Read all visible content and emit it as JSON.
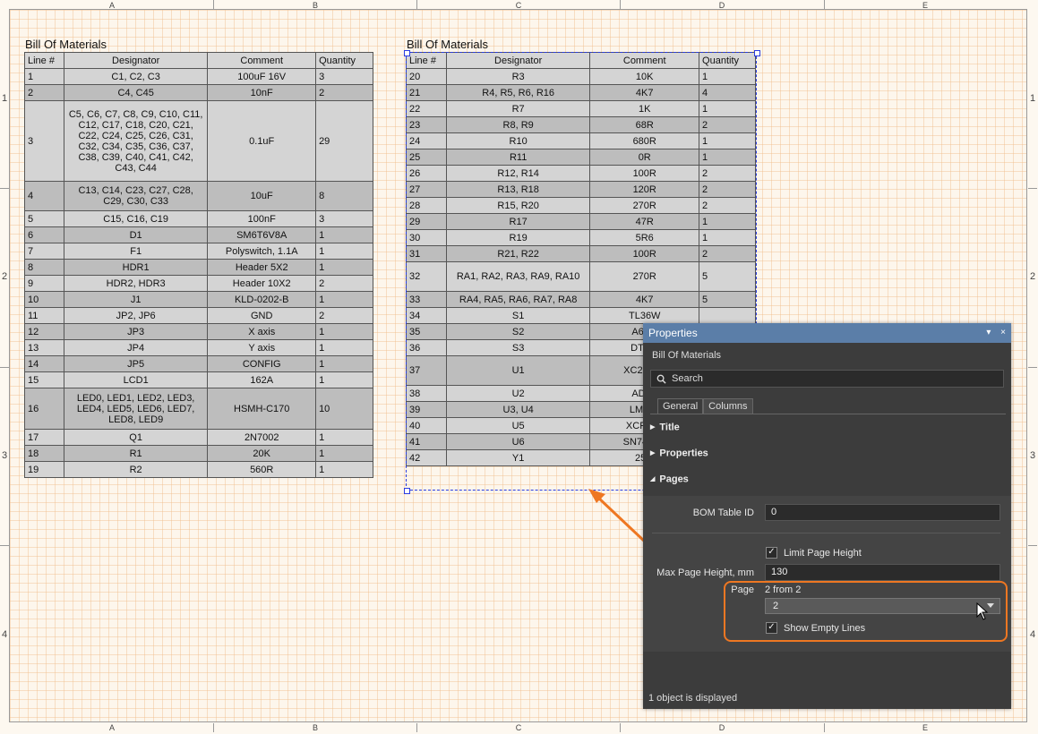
{
  "zones": {
    "cols": [
      "A",
      "B",
      "C",
      "D",
      "E"
    ],
    "rows": [
      "1",
      "2",
      "3",
      "4"
    ]
  },
  "bom1": {
    "title": "Bill Of Materials",
    "headers": [
      "Line #",
      "Designator",
      "Comment",
      "Quantity"
    ],
    "rows": [
      [
        "1",
        "C1, C2, C3",
        "100uF 16V",
        "3"
      ],
      [
        "2",
        "C4, C45",
        "10nF",
        "2"
      ],
      [
        "3",
        "C5, C6, C7, C8, C9, C10, C11, C12, C17, C18, C20, C21, C22, C24, C25, C26, C31, C32, C34, C35, C36, C37, C38, C39, C40, C41, C42, C43, C44",
        "0.1uF",
        "29"
      ],
      [
        "4",
        "C13, C14, C23, C27, C28, C29, C30, C33",
        "10uF",
        "8"
      ],
      [
        "5",
        "C15, C16, C19",
        "100nF",
        "3"
      ],
      [
        "6",
        "D1",
        "SM6T6V8A",
        "1"
      ],
      [
        "7",
        "F1",
        "Polyswitch, 1.1A",
        "1"
      ],
      [
        "8",
        "HDR1",
        "Header 5X2",
        "1"
      ],
      [
        "9",
        "HDR2, HDR3",
        "Header 10X2",
        "2"
      ],
      [
        "10",
        "J1",
        "KLD-0202-B",
        "1"
      ],
      [
        "11",
        "JP2, JP6",
        "GND",
        "2"
      ],
      [
        "12",
        "JP3",
        "X axis",
        "1"
      ],
      [
        "13",
        "JP4",
        "Y axis",
        "1"
      ],
      [
        "14",
        "JP5",
        "CONFIG",
        "1"
      ],
      [
        "15",
        "LCD1",
        "162A",
        "1"
      ],
      [
        "16",
        "LED0, LED1, LED2, LED3, LED4, LED5, LED6, LED7, LED8, LED9",
        "HSMH-C170",
        "10"
      ],
      [
        "17",
        "Q1",
        "2N7002",
        "1"
      ],
      [
        "18",
        "R1",
        "20K",
        "1"
      ],
      [
        "19",
        "R2",
        "560R",
        "1"
      ]
    ]
  },
  "bom2": {
    "title": "Bill Of Materials",
    "headers": [
      "Line #",
      "Designator",
      "Comment",
      "Quantity"
    ],
    "rows": [
      [
        "20",
        "R3",
        "10K",
        "1"
      ],
      [
        "21",
        "R4, R5, R6, R16",
        "4K7",
        "4"
      ],
      [
        "22",
        "R7",
        "1K",
        "1"
      ],
      [
        "23",
        "R8, R9",
        "68R",
        "2"
      ],
      [
        "24",
        "R10",
        "680R",
        "1"
      ],
      [
        "25",
        "R11",
        "0R",
        "1"
      ],
      [
        "26",
        "R12, R14",
        "100R",
        "2"
      ],
      [
        "27",
        "R13, R18",
        "120R",
        "2"
      ],
      [
        "28",
        "R15, R20",
        "270R",
        "2"
      ],
      [
        "29",
        "R17",
        "47R",
        "1"
      ],
      [
        "30",
        "R19",
        "5R6",
        "1"
      ],
      [
        "31",
        "R21, R22",
        "100R",
        "2"
      ],
      [
        "32",
        "RA1, RA2, RA3, RA9, RA10",
        "270R",
        "5"
      ],
      [
        "33",
        "RA4, RA5, RA6, RA7, RA8",
        "4K7",
        "5"
      ],
      [
        "34",
        "S1",
        "TL36W",
        ""
      ],
      [
        "35",
        "S2",
        "A6ER",
        ""
      ],
      [
        "36",
        "S3",
        "DTSM",
        ""
      ],
      [
        "37",
        "U1",
        "XC2S300",
        ""
      ],
      [
        "38",
        "U2",
        "ADXL",
        ""
      ],
      [
        "39",
        "U3, U4",
        "LM108",
        ""
      ],
      [
        "40",
        "U5",
        "XCF02S",
        ""
      ],
      [
        "41",
        "U6",
        "SN74LVC",
        ""
      ],
      [
        "42",
        "Y1",
        "25M",
        ""
      ]
    ]
  },
  "panel": {
    "title": "Properties",
    "pin_icon": "▾",
    "close_icon": "×",
    "object_type": "Bill Of Materials",
    "search_placeholder": "Search",
    "tabs": [
      "General",
      "Columns"
    ],
    "sections": [
      "Title",
      "Properties",
      "Pages"
    ],
    "bom_table_id_label": "BOM Table ID",
    "bom_table_id_value": "0",
    "limit_page_height_label": "Limit Page Height",
    "max_page_height_label": "Max Page Height, mm",
    "max_page_height_value": "130",
    "page_label": "Page",
    "page_info": "2 from 2",
    "page_value": "2",
    "show_empty_lines_label": "Show Empty Lines",
    "status": "1 object is displayed"
  },
  "colors": {
    "accent_orange": "#ee7722",
    "panel_header": "#5b7ea8",
    "selection_blue": "#2a3ce0"
  }
}
